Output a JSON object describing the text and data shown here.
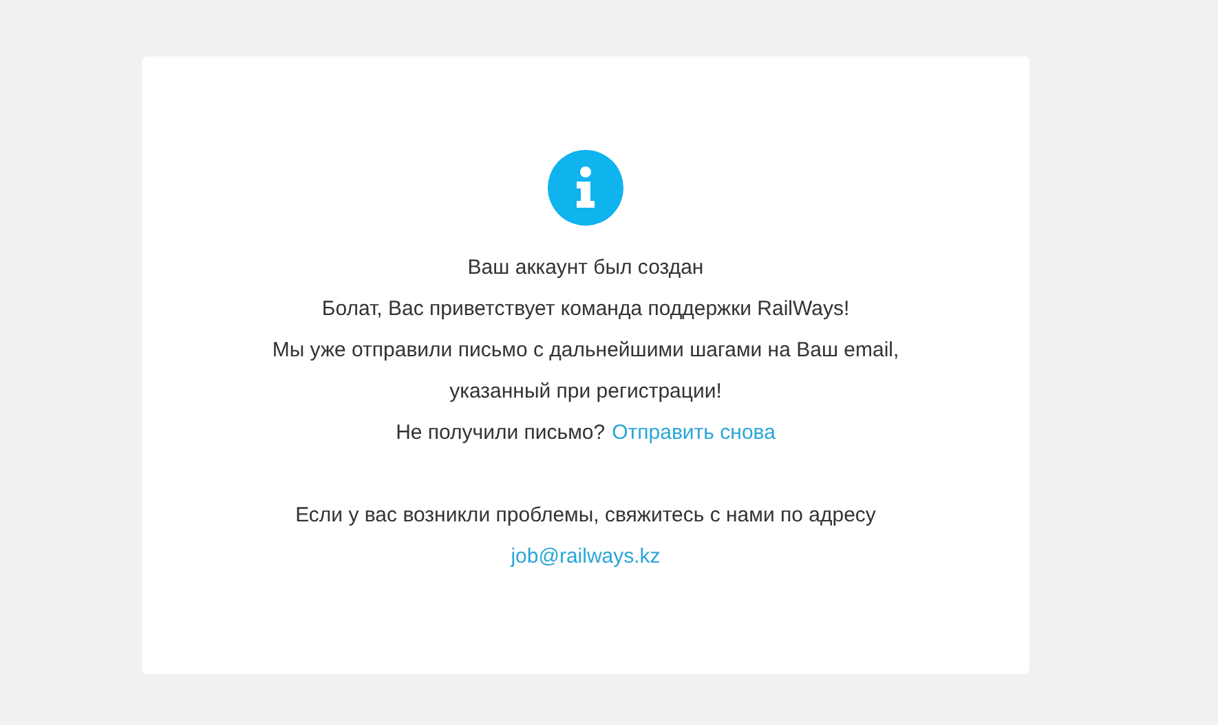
{
  "card": {
    "title": "Ваш аккаунт был создан",
    "greeting": "Болат, Вас приветствует команда поддержки RailWays!",
    "message": "Мы уже отправили письмо с дальнейшими шагами на Ваш email, указанный при регистрации!",
    "resend_prompt": "Не получили письмо?",
    "resend_link": "Отправить снова",
    "contact_text": "Если у вас возникли проблемы, свяжитесь с нами по адресу",
    "contact_email": "job@railways.kz"
  }
}
